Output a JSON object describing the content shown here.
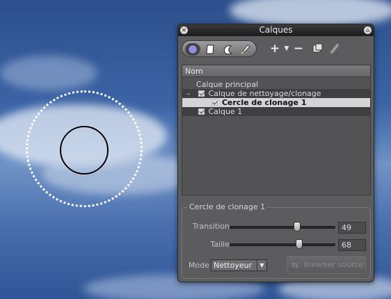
{
  "panel": {
    "title": "Calques",
    "close_icon": "close-icon",
    "info_icon": "info-icon"
  },
  "toolbar": {
    "tools": [
      "circle-tool-icon",
      "polygon-tool-icon",
      "lasso-tool-icon",
      "brush-tool-icon"
    ],
    "actions": [
      "add-icon",
      "add-dropdown-icon",
      "remove-icon",
      "duplicate-layer-icon",
      "disable-layer-icon"
    ]
  },
  "layers": {
    "header": "Nom",
    "rows": [
      {
        "label": "Calque principal"
      },
      {
        "label": "Calque de nettoyage/clonage",
        "expander": "–"
      },
      {
        "label": "Cercle de clonage 1"
      },
      {
        "label": "Calque 1"
      }
    ]
  },
  "properties": {
    "group_title": "Cercle de clonage 1",
    "transition_label": "Transition",
    "transition_value": "49",
    "taille_label": "Taille",
    "taille_value": "68",
    "mode_label": "Mode",
    "mode_value": "Nettoyeur",
    "invert_source_label": "Inverser source"
  },
  "colors": {
    "panel_bg": "#5c5c5e",
    "selected_row": "#d4d4d6",
    "active_tool": "#8f8fd8"
  }
}
